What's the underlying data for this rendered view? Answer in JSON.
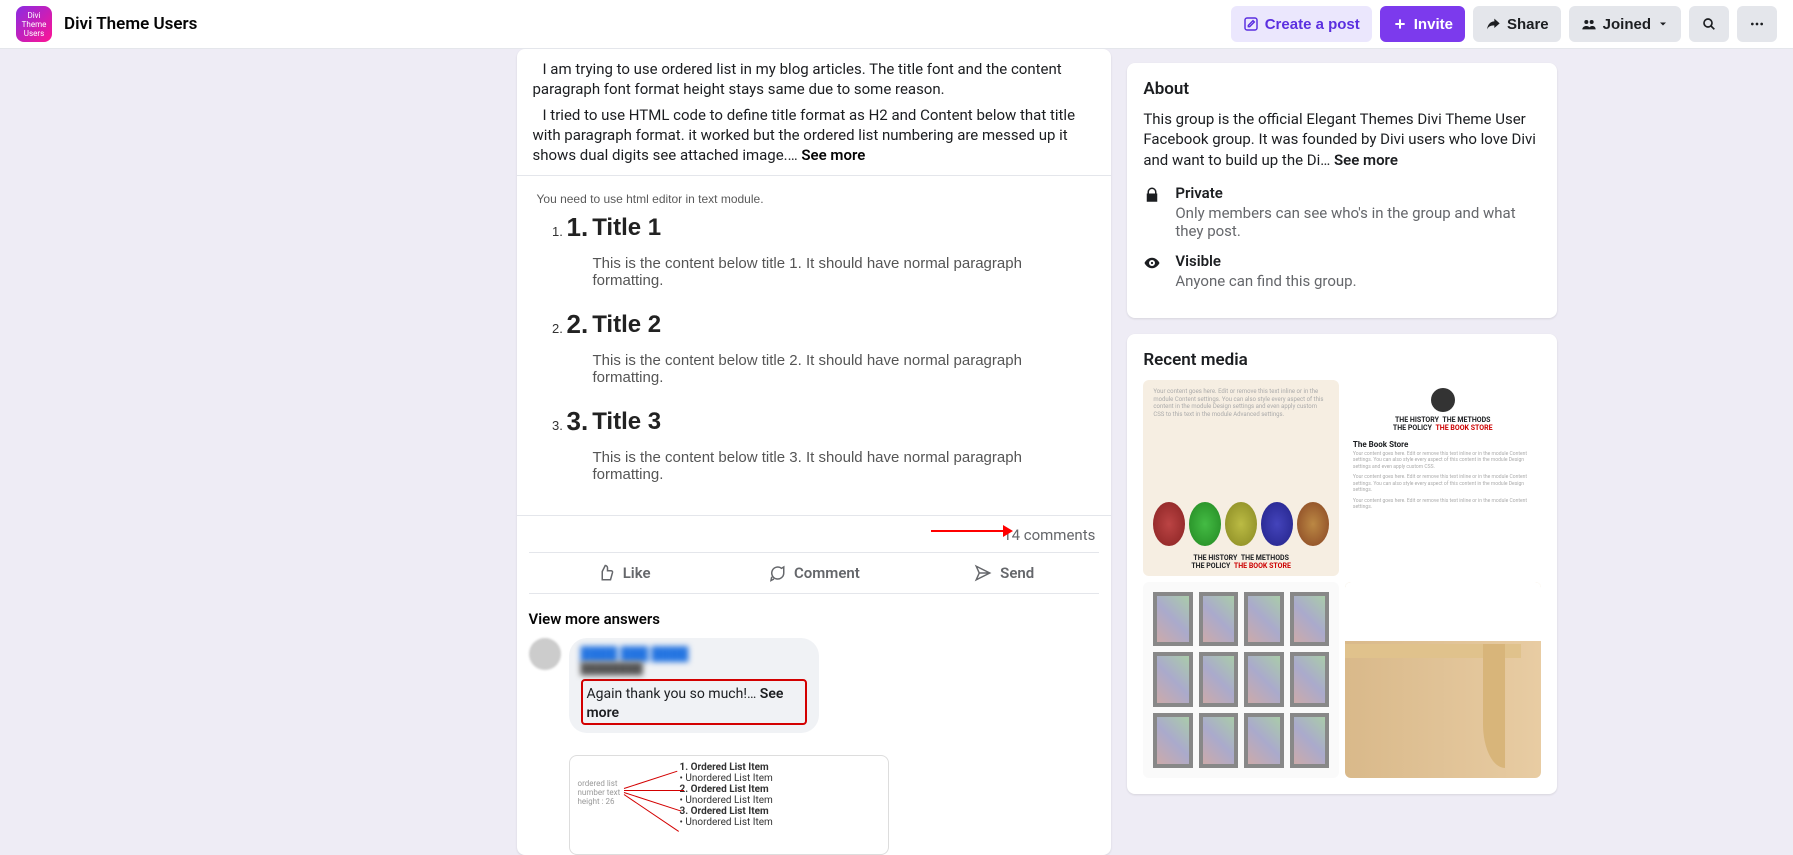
{
  "topbar": {
    "group_name": "Divi Theme Users",
    "create_post": "Create a post",
    "invite": "Invite",
    "share": "Share",
    "joined": "Joined"
  },
  "post": {
    "para1": "I am trying to use ordered list in my blog articles. The title font and the content paragraph font format height stays same due to some reason.",
    "para2_pre": "I tried to use HTML code to define title format as H2 and Content below that title with paragraph format. it worked but the ordered list numbering are messed up it shows dual digits see attached image.… ",
    "see_more": "See more"
  },
  "attachment": {
    "hint": "You need to use html editor in text module.",
    "items": [
      {
        "num": "1.",
        "title": "Title 1",
        "desc": "This is the content below title 1. It should have normal paragraph formatting."
      },
      {
        "num": "2.",
        "title": "Title 2",
        "desc": "This is the content below title 2. It should have normal paragraph formatting."
      },
      {
        "num": "3.",
        "title": "Title 3",
        "desc": "This is the content below title 3. It should have normal paragraph formatting."
      }
    ]
  },
  "meta": {
    "comments": "14 comments"
  },
  "actions": {
    "like": "Like",
    "comment": "Comment",
    "send": "Send"
  },
  "view_more": "View more answers",
  "comment": {
    "name_blur": "████ ███ ████",
    "sub_blur": "████████",
    "text_pre": "Again thank you so much!… ",
    "see_more": "See more",
    "nested_label": "ordered list\nnumber text\nheight : 26",
    "nested_items": [
      "1. Ordered List Item",
      "   • Unordered List Item",
      "2. Ordered List Item",
      "   • Unordered List Item",
      "3. Ordered List Item",
      "   • Unordered List Item"
    ]
  },
  "about": {
    "heading": "About",
    "text_pre": "This group is the official Elegant Themes Divi Theme User Facebook group. It was founded by Divi users who love Divi and want to build up the Di… ",
    "see_more": "See more",
    "private_t": "Private",
    "private_d": "Only members can see who's in the group and what they post.",
    "visible_t": "Visible",
    "visible_d": "Anyone can find this group."
  },
  "media": {
    "heading": "Recent media",
    "t1_cap_a": "THE HISTORY",
    "t1_cap_b": "THE METHODS",
    "t1_cap_c": "THE POLICY",
    "t1_cap_d": "THE BOOK STORE",
    "t2_store": "The Book Store"
  }
}
